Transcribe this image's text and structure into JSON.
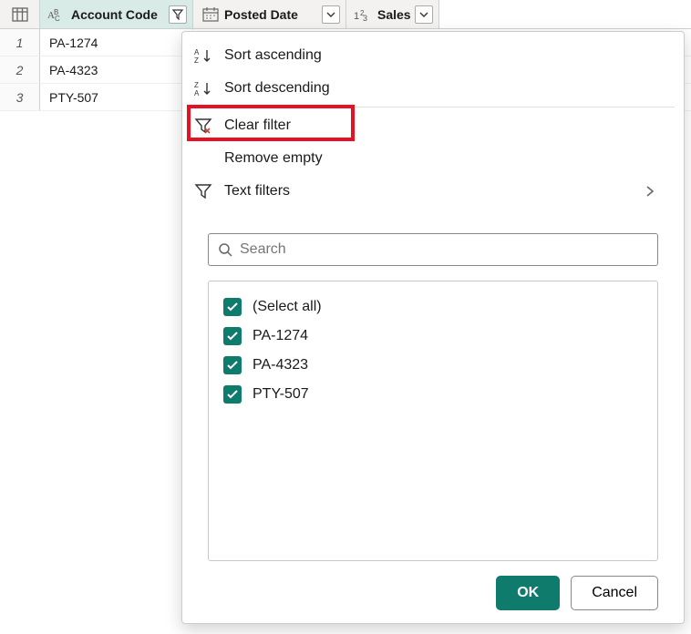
{
  "columns": {
    "account": {
      "label": "Account Code"
    },
    "posted": {
      "label": "Posted Date"
    },
    "sales": {
      "label": "Sales"
    }
  },
  "rows": [
    {
      "num": "1",
      "account": "PA-1274"
    },
    {
      "num": "2",
      "account": "PA-4323"
    },
    {
      "num": "3",
      "account": "PTY-507"
    }
  ],
  "menu": {
    "sort_asc": "Sort ascending",
    "sort_desc": "Sort descending",
    "clear_filter": "Clear filter",
    "remove_empty": "Remove empty",
    "text_filters": "Text filters"
  },
  "search": {
    "placeholder": "Search"
  },
  "values": {
    "select_all": "(Select all)",
    "items": [
      "PA-1274",
      "PA-4323",
      "PTY-507"
    ]
  },
  "buttons": {
    "ok": "OK",
    "cancel": "Cancel"
  }
}
